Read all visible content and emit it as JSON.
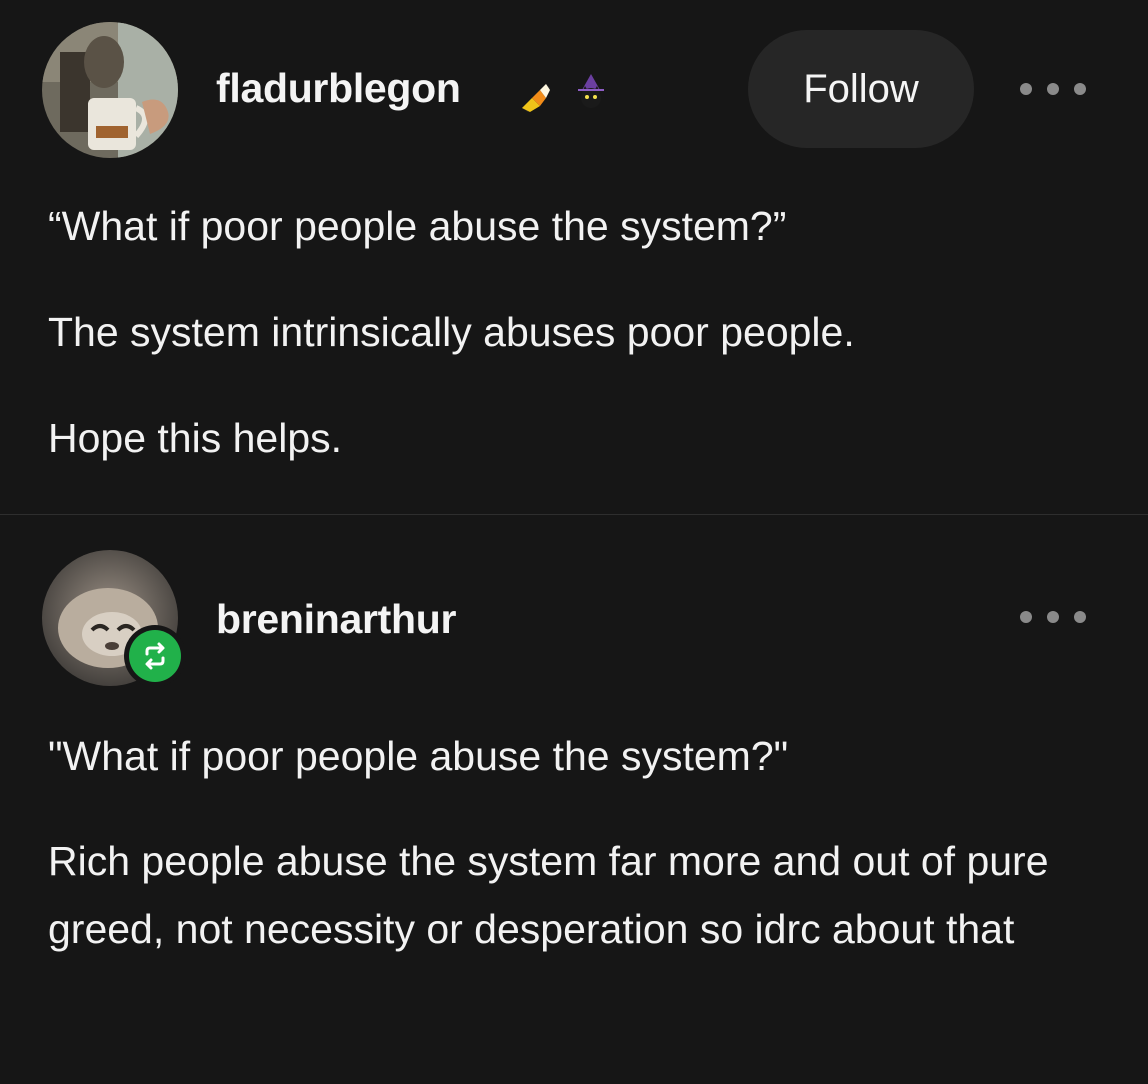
{
  "posts": [
    {
      "username": "fladurblegon",
      "badges": [
        "candy-corn-icon",
        "wizard-cat-icon"
      ],
      "follow_label": "Follow",
      "paragraphs": [
        "“What if poor people abuse the system?”",
        "The system intrinsically abuses poor people.",
        "Hope this helps."
      ]
    },
    {
      "username": "breninarthur",
      "reblog_icon": "reblog-icon",
      "paragraphs": [
        "\"What if poor people abuse the system?\"",
        "Rich people abuse the system far more and out of pure greed, not necessity or desperation so idrc about that"
      ]
    }
  ],
  "colors": {
    "background": "#161616",
    "text": "#f2f2f2",
    "follow_button_bg": "#262626",
    "reblog_green": "#21b14a",
    "dots": "#8a8a8a"
  }
}
